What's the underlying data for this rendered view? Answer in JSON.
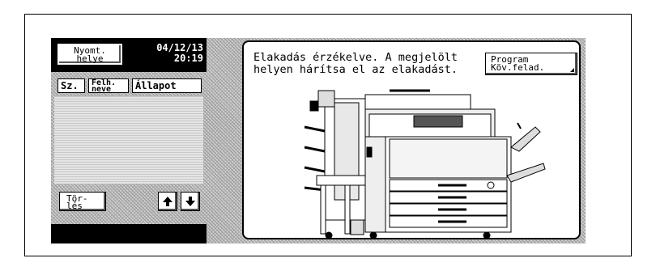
{
  "left_panel": {
    "job_location_button": {
      "line1": "Nyomt.",
      "line2": "helye"
    },
    "date": "04/12/13",
    "time": "20:19",
    "columns": [
      "Sz.",
      "Felh. neve",
      "Állapot"
    ],
    "delete_button": {
      "line1": "Tör-",
      "line2": "lés"
    },
    "up_icon": "arrow-up-icon",
    "down_icon": "arrow-down-icon"
  },
  "right_panel": {
    "message": "Elakadás érzékelve. A megjelölt\nhelyen hárítsa el az elakadást.",
    "program_button": {
      "line1": "Program",
      "line2": "Köv.felad."
    },
    "illustration": "copier-jam-illustration"
  }
}
